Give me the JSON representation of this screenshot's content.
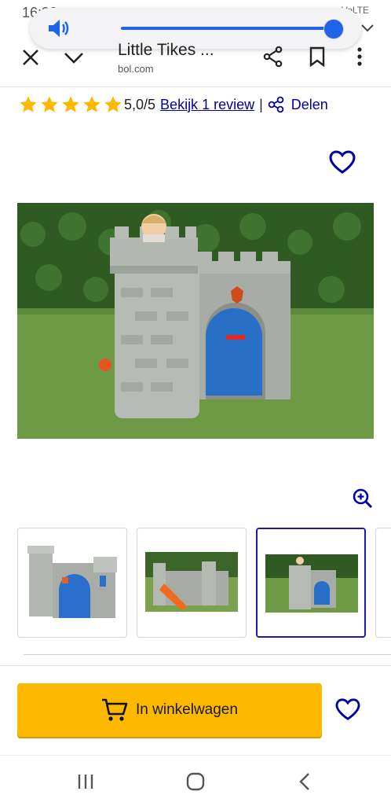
{
  "status_bar": {
    "time": "16:32",
    "signal": "VoLTE"
  },
  "volume_panel": {
    "level": 0.93
  },
  "browser": {
    "title": "Little Tikes ...",
    "domain": "bol.com"
  },
  "product": {
    "rating": {
      "stars": 5,
      "score": "5,0/5",
      "review_link": "Bekijk 1 review",
      "separator": "|",
      "share": "Delen"
    },
    "colors": {
      "accent": "#0000a4",
      "star": "#fcb900",
      "cart_button": "#fcb900"
    }
  },
  "gallery": {
    "selected_index": 2,
    "thumbnail_count": 3
  },
  "cart": {
    "button_label": "In winkelwagen"
  },
  "icons": [
    "speaker-icon",
    "chevron-down-icon",
    "close-icon",
    "share-icon",
    "bookmark-icon",
    "more-vert-icon",
    "star-icon",
    "heart-icon",
    "zoom-in-icon",
    "cart-icon",
    "recent-apps-icon",
    "home-icon",
    "back-icon"
  ]
}
